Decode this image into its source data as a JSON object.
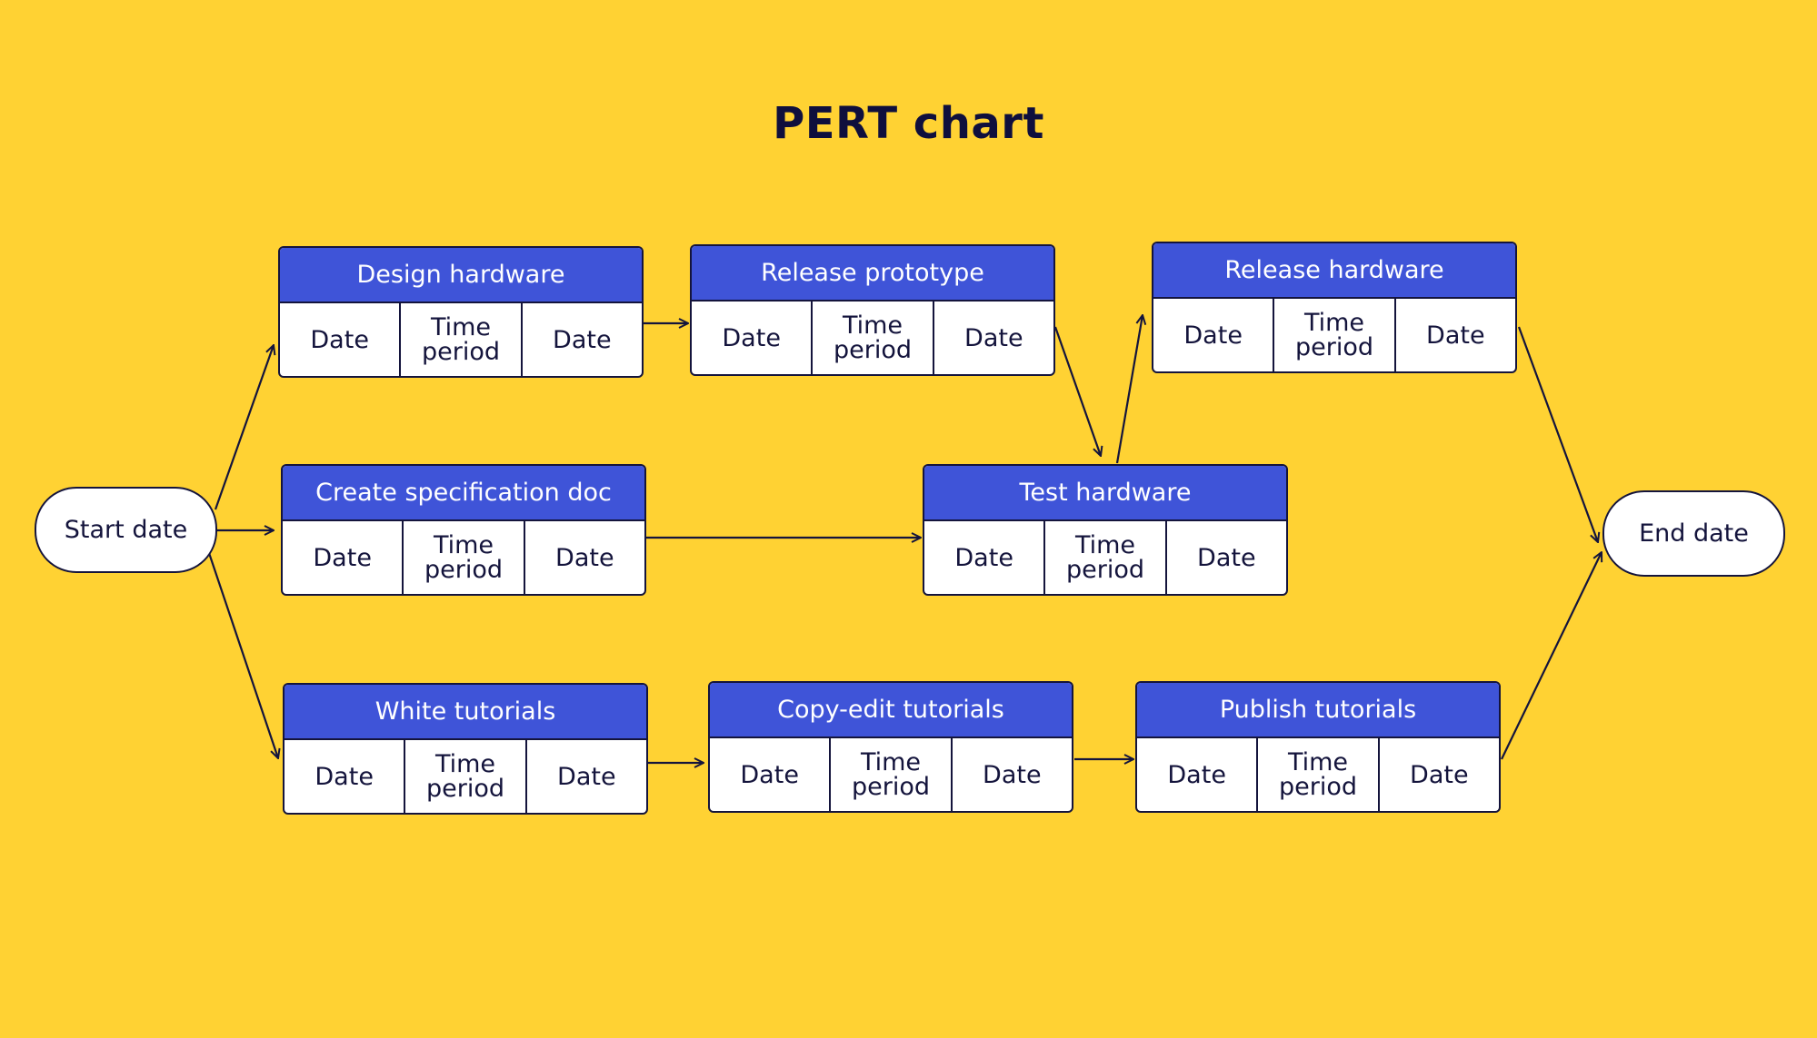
{
  "title": "PERT chart",
  "colors": {
    "background": "#FFD233",
    "task_header": "#3F54D8",
    "stroke": "#14143C",
    "node_fill": "#FFFFFF"
  },
  "start_node": {
    "label": "Start date"
  },
  "end_node": {
    "label": "End date"
  },
  "tasks": [
    {
      "id": "design-hardware",
      "name": "Design hardware",
      "cells": [
        "Date",
        "Time\nperiod",
        "Date"
      ]
    },
    {
      "id": "release-prototype",
      "name": "Release prototype",
      "cells": [
        "Date",
        "Time\nperiod",
        "Date"
      ]
    },
    {
      "id": "release-hardware",
      "name": "Release hardware",
      "cells": [
        "Date",
        "Time\nperiod",
        "Date"
      ]
    },
    {
      "id": "create-specification-doc",
      "name": "Create specification doc",
      "cells": [
        "Date",
        "Time\nperiod",
        "Date"
      ]
    },
    {
      "id": "test-hardware",
      "name": "Test hardware",
      "cells": [
        "Date",
        "Time\nperiod",
        "Date"
      ]
    },
    {
      "id": "white-tutorials",
      "name": "White tutorials",
      "cells": [
        "Date",
        "Time\nperiod",
        "Date"
      ]
    },
    {
      "id": "copy-edit-tutorials",
      "name": "Copy-edit tutorials",
      "cells": [
        "Date",
        "Time\nperiod",
        "Date"
      ]
    },
    {
      "id": "publish-tutorials",
      "name": "Publish tutorials",
      "cells": [
        "Date",
        "Time\nperiod",
        "Date"
      ]
    }
  ],
  "edges": [
    {
      "from": "start",
      "to": "design-hardware"
    },
    {
      "from": "start",
      "to": "create-specification-doc"
    },
    {
      "from": "start",
      "to": "white-tutorials"
    },
    {
      "from": "design-hardware",
      "to": "release-prototype"
    },
    {
      "from": "release-prototype",
      "to": "test-hardware"
    },
    {
      "from": "create-specification-doc",
      "to": "test-hardware"
    },
    {
      "from": "test-hardware",
      "to": "release-hardware"
    },
    {
      "from": "release-hardware",
      "to": "end"
    },
    {
      "from": "white-tutorials",
      "to": "copy-edit-tutorials"
    },
    {
      "from": "copy-edit-tutorials",
      "to": "publish-tutorials"
    },
    {
      "from": "publish-tutorials",
      "to": "end"
    }
  ]
}
